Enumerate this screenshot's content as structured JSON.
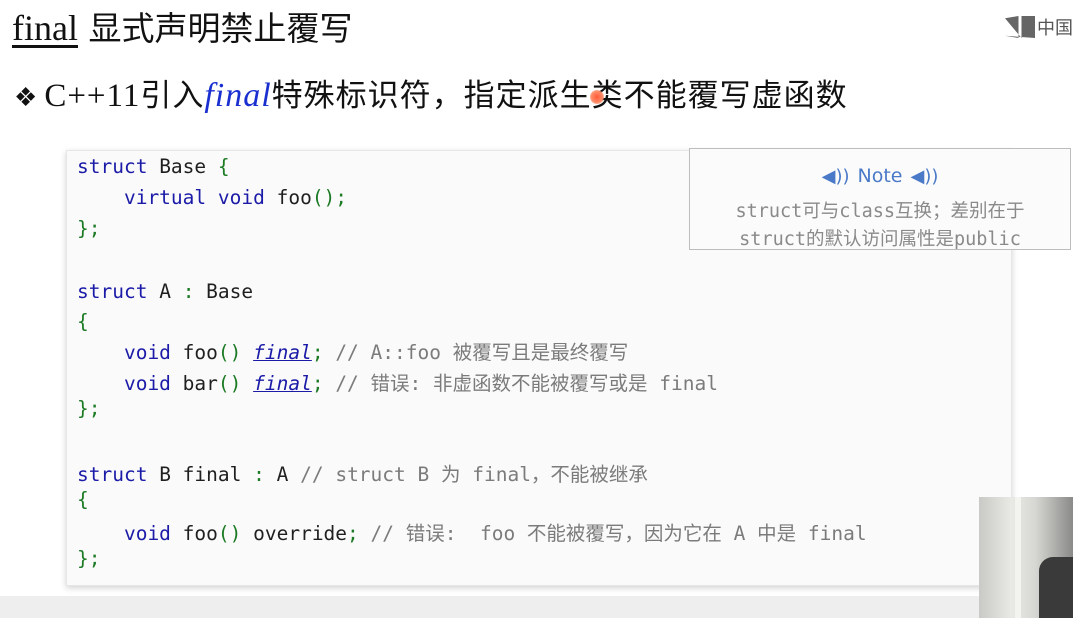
{
  "slide": {
    "title_word": "final",
    "title_rest": " 显式声明禁止覆写",
    "bullet_symbol": "❖",
    "bullet_prefix": "C++11",
    "bullet_mid1": "引入",
    "bullet_keyword": "final",
    "bullet_suffix": "特殊标识符，指定派生类不能覆写虚函数"
  },
  "logo": {
    "text": "中国"
  },
  "code": {
    "l1a": "struct",
    "l1b": " Base ",
    "l1c": "{",
    "l2a": "    virtual void",
    "l2b": " foo",
    "l2c": "();",
    "l3": "};",
    "l5a": "struct",
    "l5b": " A ",
    "l5c": ":",
    "l5d": " Base",
    "l6": "{",
    "l7a": "    void",
    "l7b": " foo",
    "l7c": "() ",
    "l7d": "final",
    "l7e": ";",
    "l7f": " // A::foo 被覆写且是最终覆写",
    "l8a": "    void",
    "l8b": " bar",
    "l8c": "() ",
    "l8d": "final",
    "l8e": ";",
    "l8f": " // 错误: 非虚函数不能被覆写或是 final",
    "l9": "};",
    "l11a": "struct",
    "l11b": " B final ",
    "l11c": ":",
    "l11d": " A ",
    "l11e": "// struct B 为 final，不能被继承",
    "l12": "{",
    "l13a": "    void",
    "l13b": " foo",
    "l13c": "()",
    "l13d": " override",
    "l13e": ";",
    "l13f": " // 错误:  foo 不能被覆写，因为它在 A 中是 final",
    "l14": "};"
  },
  "note": {
    "title": "Note",
    "line1": "struct可与class互换；差别在于",
    "line2": "struct的默认访问属性是public",
    "icon": "speaker-icon"
  }
}
